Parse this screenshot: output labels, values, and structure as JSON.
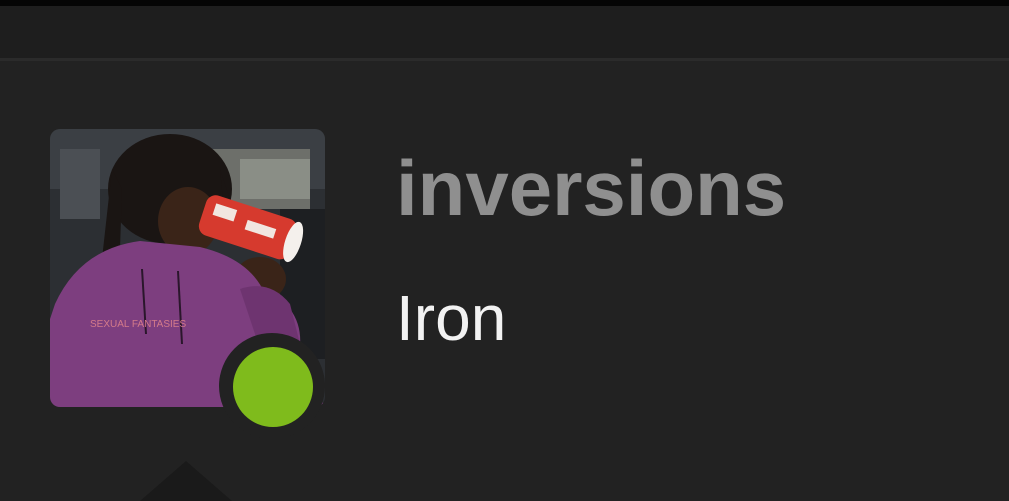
{
  "profile": {
    "username": "inversions",
    "rank": "Iron",
    "avatar_icon": "user-avatar-photo",
    "status_icon": "online-status-dot",
    "status_color": "#7fbb1c",
    "username_color": "#8f8f8f",
    "rank_color": "#f2f2f2",
    "avatar_shirt_text": "SEXUAL FANTASIES"
  }
}
